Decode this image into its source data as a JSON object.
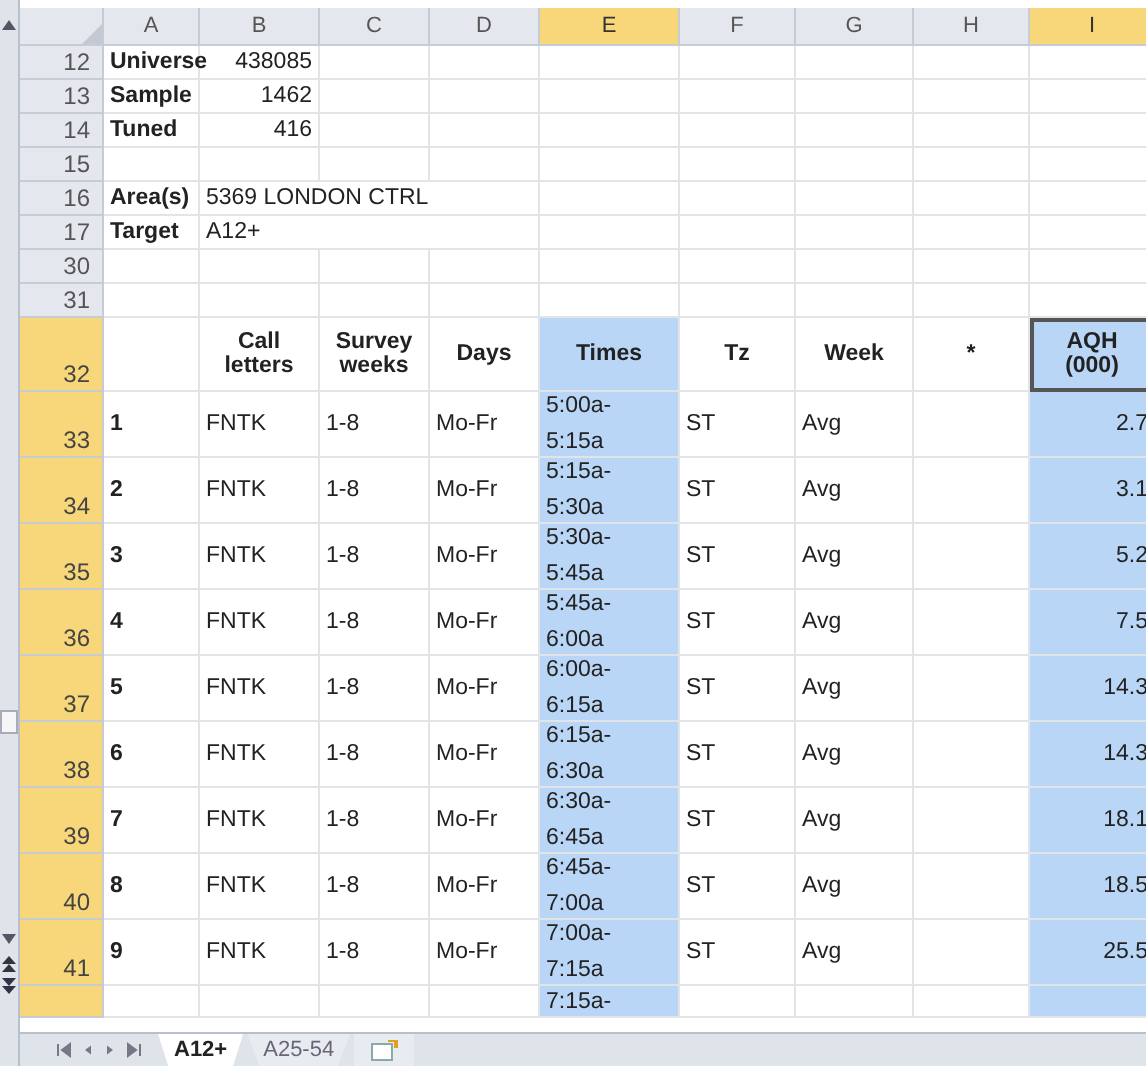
{
  "columns": [
    {
      "label": "A",
      "selected": false
    },
    {
      "label": "B",
      "selected": false
    },
    {
      "label": "C",
      "selected": false
    },
    {
      "label": "D",
      "selected": false
    },
    {
      "label": "E",
      "selected": true
    },
    {
      "label": "F",
      "selected": false
    },
    {
      "label": "G",
      "selected": false
    },
    {
      "label": "H",
      "selected": false
    },
    {
      "label": "I",
      "selected": true,
      "active": true
    }
  ],
  "rows": [
    {
      "number": "12",
      "kind": "stat",
      "selected": false,
      "cells": {
        "A": "Universe",
        "B": "438085"
      }
    },
    {
      "number": "13",
      "kind": "stat",
      "selected": false,
      "cells": {
        "A": "Sample",
        "B": "1462"
      }
    },
    {
      "number": "14",
      "kind": "stat",
      "selected": false,
      "cells": {
        "A": "Tuned",
        "B": "416"
      }
    },
    {
      "number": "15",
      "kind": "blank",
      "selected": false,
      "cells": {}
    },
    {
      "number": "16",
      "kind": "info",
      "selected": false,
      "cells": {
        "A": "Area(s)",
        "B": "5369 LONDON CTRL"
      }
    },
    {
      "number": "17",
      "kind": "info",
      "selected": false,
      "cells": {
        "A": "Target",
        "B": "A12+"
      }
    },
    {
      "number": "30",
      "kind": "blank",
      "selected": false,
      "cells": {}
    },
    {
      "number": "31",
      "kind": "blank",
      "selected": false,
      "cells": {}
    },
    {
      "number": "32",
      "kind": "header",
      "selected": true,
      "active": true,
      "cells": {
        "B": "Call letters",
        "C": "Survey weeks",
        "D": "Days",
        "E": "Times",
        "F": "Tz",
        "G": "Week",
        "H": "*",
        "I": "AQH (000)"
      }
    },
    {
      "number": "33",
      "kind": "data",
      "selected": true,
      "cells": {
        "A": "1",
        "B": "FNTK",
        "C": "1-8",
        "D": "Mo-Fr",
        "E": "5:00a- 5:15a",
        "F": "ST",
        "G": "Avg",
        "I": "2.7"
      }
    },
    {
      "number": "34",
      "kind": "data",
      "selected": true,
      "cells": {
        "A": "2",
        "B": "FNTK",
        "C": "1-8",
        "D": "Mo-Fr",
        "E": "5:15a- 5:30a",
        "F": "ST",
        "G": "Avg",
        "I": "3.1"
      }
    },
    {
      "number": "35",
      "kind": "data",
      "selected": true,
      "cells": {
        "A": "3",
        "B": "FNTK",
        "C": "1-8",
        "D": "Mo-Fr",
        "E": "5:30a- 5:45a",
        "F": "ST",
        "G": "Avg",
        "I": "5.2"
      }
    },
    {
      "number": "36",
      "kind": "data",
      "selected": true,
      "cells": {
        "A": "4",
        "B": "FNTK",
        "C": "1-8",
        "D": "Mo-Fr",
        "E": "5:45a- 6:00a",
        "F": "ST",
        "G": "Avg",
        "I": "7.5"
      }
    },
    {
      "number": "37",
      "kind": "data",
      "selected": true,
      "cells": {
        "A": "5",
        "B": "FNTK",
        "C": "1-8",
        "D": "Mo-Fr",
        "E": "6:00a- 6:15a",
        "F": "ST",
        "G": "Avg",
        "I": "14.3"
      }
    },
    {
      "number": "38",
      "kind": "data",
      "selected": true,
      "cells": {
        "A": "6",
        "B": "FNTK",
        "C": "1-8",
        "D": "Mo-Fr",
        "E": "6:15a- 6:30a",
        "F": "ST",
        "G": "Avg",
        "I": "14.3"
      }
    },
    {
      "number": "39",
      "kind": "data",
      "selected": true,
      "cells": {
        "A": "7",
        "B": "FNTK",
        "C": "1-8",
        "D": "Mo-Fr",
        "E": "6:30a- 6:45a",
        "F": "ST",
        "G": "Avg",
        "I": "18.1"
      }
    },
    {
      "number": "40",
      "kind": "data",
      "selected": true,
      "cells": {
        "A": "8",
        "B": "FNTK",
        "C": "1-8",
        "D": "Mo-Fr",
        "E": "6:45a- 7:00a",
        "F": "ST",
        "G": "Avg",
        "I": "18.5"
      }
    },
    {
      "number": "41",
      "kind": "data",
      "selected": true,
      "cells": {
        "A": "9",
        "B": "FNTK",
        "C": "1-8",
        "D": "Mo-Fr",
        "E": "7:00a- 7:15a",
        "F": "ST",
        "G": "Avg",
        "I": "25.5"
      }
    },
    {
      "kind": "partial",
      "selected": true,
      "cells": {
        "E": "7:15a-"
      }
    }
  ],
  "sheet_tabs": [
    {
      "label": "A12+",
      "selected": true
    },
    {
      "label": "A25-54",
      "selected": false
    }
  ]
}
